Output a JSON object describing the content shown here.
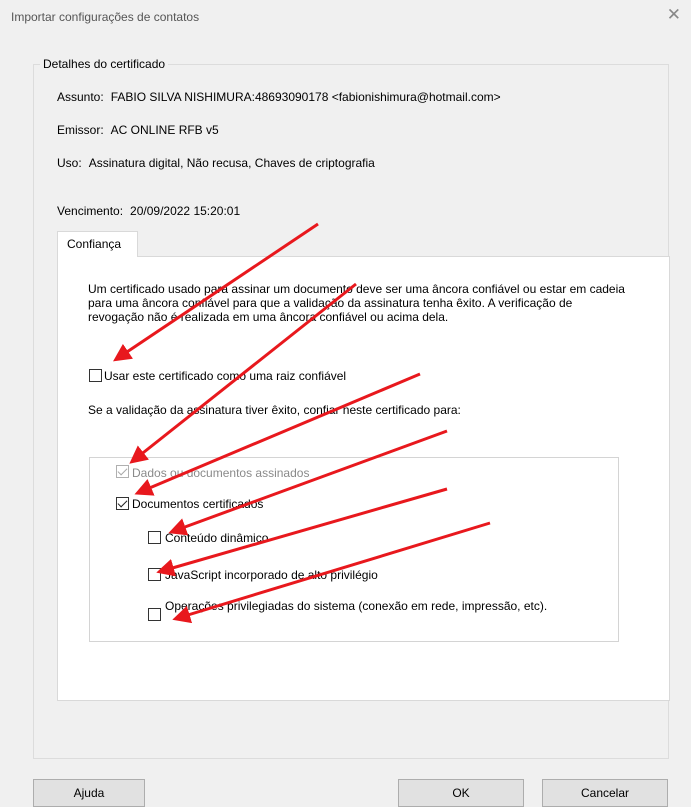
{
  "window": {
    "title": "Importar configurações de contatos",
    "close_glyph": "✕"
  },
  "details": {
    "legend": "Detalhes do certificado",
    "subject_label": "Assunto:",
    "subject_value": "FABIO SILVA NISHIMURA:48693090178 <fabionishimura@hotmail.com>",
    "issuer_label": "Emissor:",
    "issuer_value": "AC ONLINE RFB v5",
    "usage_label": "Uso:",
    "usage_value": "Assinatura digital, Não recusa, Chaves de criptografia",
    "expiry_label": "Vencimento:",
    "expiry_value": "20/09/2022 15:20:01"
  },
  "tabs": [
    {
      "label": "Confiança",
      "selected": true
    }
  ],
  "trust": {
    "description": "Um certificado usado para assinar um documento deve ser uma âncora confiável ou estar em cadeia para uma âncora confiável para que a validação da assinatura tenha êxito. A verificação de revogação não é realizada em uma âncora confiável ou acima dela.",
    "use_as_root_label": "Usar este certificado como uma raiz confiável",
    "use_as_root_checked": false,
    "trust_for_label": "Se a validação da assinatura tiver êxito, confiar neste certificado para:",
    "options": {
      "signed_data": {
        "label": "Dados ou documentos assinados",
        "checked": true,
        "disabled": true
      },
      "certified_docs": {
        "label": "Documentos certificados",
        "checked": true,
        "disabled": false
      },
      "dynamic_content": {
        "label": "Conteúdo dinâmico",
        "checked": false,
        "disabled": false
      },
      "javascript": {
        "label": "JavaScript incorporado de alto privilégio",
        "checked": false,
        "disabled": false
      },
      "privileged_ops": {
        "label": "Operações privilegiadas do sistema (conexão em rede, impressão, etc).",
        "checked": false,
        "disabled": false
      }
    }
  },
  "buttons": {
    "help": "Ajuda",
    "ok": "OK",
    "cancel": "Cancelar"
  },
  "annotation_color": "#e8181d"
}
